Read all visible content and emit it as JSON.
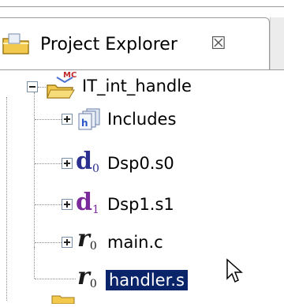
{
  "view": {
    "title": "Project Explorer",
    "close_glyph": "☒"
  },
  "tree": {
    "project": {
      "label": "IT_int_handle",
      "badge": "MC",
      "icon": "project-folder-icon",
      "expander": "minus"
    },
    "children": [
      {
        "label": "Includes",
        "icon": "includes-icon",
        "expander": "plus"
      },
      {
        "label": "Dsp0.s0",
        "icon": "dsp0-file-icon",
        "glyph": "d",
        "sub": "0",
        "expander": "plus"
      },
      {
        "label": "Dsp1.s1",
        "icon": "dsp1-file-icon",
        "glyph": "d",
        "sub": "1",
        "expander": "plus"
      },
      {
        "label": "main.c",
        "icon": "c-source-icon",
        "glyph": "r",
        "sub": "0",
        "expander": "plus"
      },
      {
        "label": "handler.s",
        "icon": "asm-source-icon",
        "glyph": "r",
        "sub": "0",
        "selected": true
      }
    ]
  },
  "colors": {
    "selection_bg": "#0a246a",
    "selection_fg": "#ffffff",
    "folder_yellow": "#f2c94c",
    "border_gray": "#9a9a9a"
  }
}
